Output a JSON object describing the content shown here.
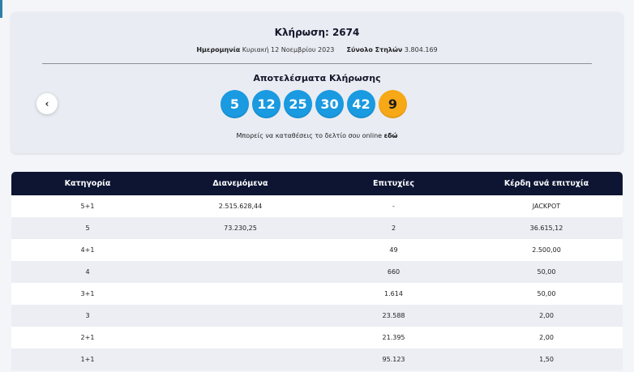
{
  "draw": {
    "title": "Κλήρωση: 2674",
    "date_label": "Ημερομηνία",
    "date_value": "Κυριακή 12 Νοεμβρίου 2023",
    "columns_label": "Σύνολο Στηλών",
    "columns_value": "3.804.169",
    "results_title": "Αποτελέσματα Κλήρωσης",
    "numbers": [
      "5",
      "12",
      "25",
      "30",
      "42"
    ],
    "joker": "9",
    "prev_icon": "chevron-left-icon",
    "prev_glyph": "‹",
    "online_text": "Μπορείς να καταθέσεις το δελτίο σου online",
    "online_link": "εδώ"
  },
  "colors": {
    "ball": "#1a9ae0",
    "joker": "#f7a817",
    "header": "#0d1533"
  },
  "table": {
    "headers": [
      "Κατηγορία",
      "Διανεμόμενα",
      "Επιτυχίες",
      "Κέρδη ανά επιτυχία"
    ],
    "rows": [
      [
        "5+1",
        "2.515.628,44",
        "-",
        "JACKPOT"
      ],
      [
        "5",
        "73.230,25",
        "2",
        "36.615,12"
      ],
      [
        "4+1",
        "",
        "49",
        "2.500,00"
      ],
      [
        "4",
        "",
        "660",
        "50,00"
      ],
      [
        "3+1",
        "",
        "1.614",
        "50,00"
      ],
      [
        "3",
        "",
        "23.588",
        "2,00"
      ],
      [
        "2+1",
        "",
        "21.395",
        "2,00"
      ],
      [
        "1+1",
        "",
        "95.123",
        "1,50"
      ]
    ]
  }
}
